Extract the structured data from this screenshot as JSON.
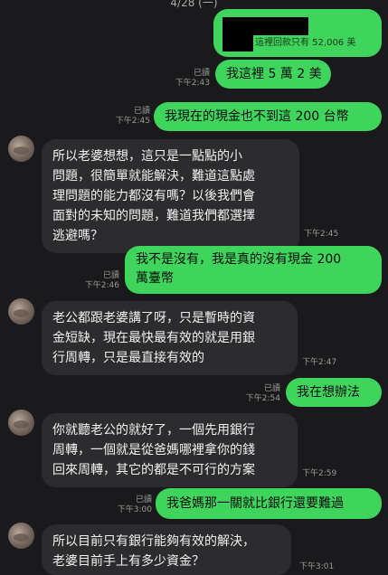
{
  "date_header": "4/28 (一)",
  "colors": {
    "outgoing": "#3fd45c",
    "incoming": "#2c2c2f",
    "background": "#1a1a1c"
  },
  "messages": [
    {
      "id": "m1",
      "dir": "out",
      "text_small": "這裡回款只有 52,006 美",
      "read": "",
      "time": ""
    },
    {
      "id": "m2",
      "dir": "out",
      "text": "我這裡 5 萬 2 美",
      "read": "已讀",
      "time": "下午2:43"
    },
    {
      "id": "m3",
      "dir": "out",
      "text": "我現在的現金也不到這 200 台幣",
      "read": "已讀",
      "time": "下午2:45"
    },
    {
      "id": "m4",
      "dir": "in",
      "lines": [
        "所以老婆想想，這只是一點點的小",
        "問題，很簡單就能解決，難道這點處",
        "理問題的能力都沒有嗎？以後我們會",
        "面對的未知的問題，難道我們都選擇",
        "逃避嗎？"
      ],
      "time": "下午2:45"
    },
    {
      "id": "m5",
      "dir": "out",
      "lines": [
        "我不是沒有，我是真的沒有現金 200",
        "萬臺幣"
      ],
      "read": "已讀",
      "time": "下午2:46"
    },
    {
      "id": "m6",
      "dir": "in",
      "lines": [
        "老公都跟老婆講了呀，只是暫時的資",
        "金短缺，現在最快最有效的就是用銀",
        "行周轉，只是最直接有效的"
      ],
      "time": "下午2:47"
    },
    {
      "id": "m7",
      "dir": "out",
      "text": "我在想辦法",
      "read": "已讀",
      "time": "下午2:54"
    },
    {
      "id": "m8",
      "dir": "in",
      "lines": [
        "你就聽老公的就好了，一個先用銀行",
        "周轉，一個就是從爸媽哪裡拿你的錢",
        "回來周轉，其它的都是不可行的方案"
      ],
      "time": "下午2:59"
    },
    {
      "id": "m9",
      "dir": "out",
      "text": "我爸媽那一關就比銀行還要難過",
      "read": "已讀",
      "time": "下午3:00"
    },
    {
      "id": "m10",
      "dir": "in",
      "lines": [
        "所以目前只有銀行能夠有效的解決，",
        "老婆目前手上有多少資金？"
      ],
      "time": "下午3:01"
    }
  ]
}
